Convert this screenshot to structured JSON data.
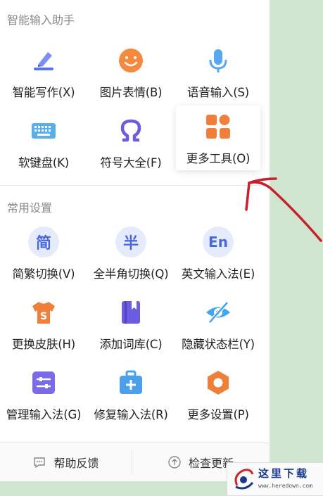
{
  "sections": {
    "smart": {
      "title": "智能输入助手"
    },
    "common": {
      "title": "常用设置"
    }
  },
  "smart_items": [
    {
      "label": "智能写作(X)",
      "icon": "pen-write-icon"
    },
    {
      "label": "图片表情(B)",
      "icon": "smiley-face-icon"
    },
    {
      "label": "语音输入(S)",
      "icon": "microphone-icon"
    },
    {
      "label": "软键盘(K)",
      "icon": "keyboard-icon"
    },
    {
      "label": "符号大全(F)",
      "icon": "omega-symbol-icon"
    },
    {
      "label": "更多工具(O)",
      "icon": "tools-grid-icon"
    }
  ],
  "common_items": [
    {
      "label": "简繁切换(V)",
      "icon_text": "简",
      "icon": "simplified-traditional-icon"
    },
    {
      "label": "全半角切换(Q)",
      "icon_text": "半",
      "icon": "half-width-icon"
    },
    {
      "label": "英文输入法(E)",
      "icon_text": "En",
      "icon": "english-input-icon"
    },
    {
      "label": "更换皮肤(H)",
      "icon_text": "S",
      "icon": "skin-shirt-icon"
    },
    {
      "label": "添加词库(C)",
      "icon": "dictionary-book-icon"
    },
    {
      "label": "隐藏状态栏(Y)",
      "icon": "hidden-eye-icon"
    },
    {
      "label": "管理输入法(G)",
      "icon": "manage-sliders-icon"
    },
    {
      "label": "修复输入法(R)",
      "icon": "repair-toolbox-icon"
    },
    {
      "label": "更多设置(P)",
      "icon": "settings-hexagon-icon"
    }
  ],
  "footer": {
    "help": "帮助反馈",
    "check": "检查更新"
  },
  "watermark": {
    "text": "这里下载",
    "url": "www.heredown.com"
  },
  "colors": {
    "accent_blue": "#4a68d8",
    "orange": "#f07f3c",
    "annotation_red": "#c8202a"
  }
}
